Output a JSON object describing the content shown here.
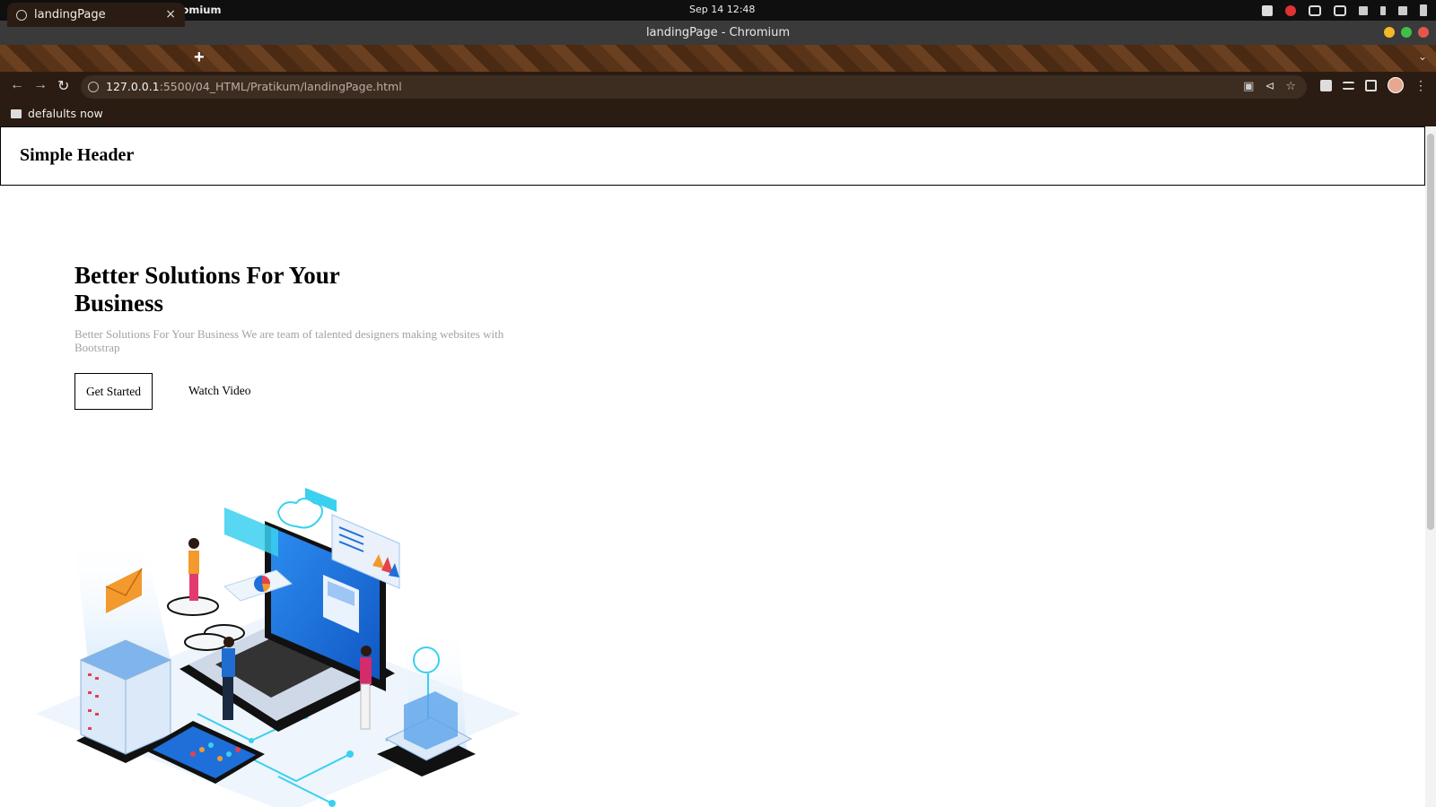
{
  "os": {
    "app_name": "Peramban Web Chromium",
    "clock": "Sep 14  12:48"
  },
  "window": {
    "title": "landingPage - Chromium"
  },
  "tab": {
    "title": "landingPage",
    "close": "×",
    "new": "+"
  },
  "address": {
    "host": "127.0.0.1",
    "path": ":5500/04_HTML/Pratikum/landingPage.html"
  },
  "bookmarks": [
    {
      "label": "defalults now"
    }
  ],
  "page": {
    "header": "Simple Header",
    "hero_title": "Better Solutions For Your Business",
    "hero_text": "Better Solutions For Your Business We are team of talented designers making websites with Bootstrap",
    "btn_primary": "Get Started",
    "btn_secondary": "Watch Video"
  },
  "colors": {
    "close": "#e2574c",
    "minimize": "#f5b829",
    "maximize": "#3fbf4a",
    "accent_cyan": "#3ad0f0",
    "illustration_blue": "#1e6fd9"
  }
}
